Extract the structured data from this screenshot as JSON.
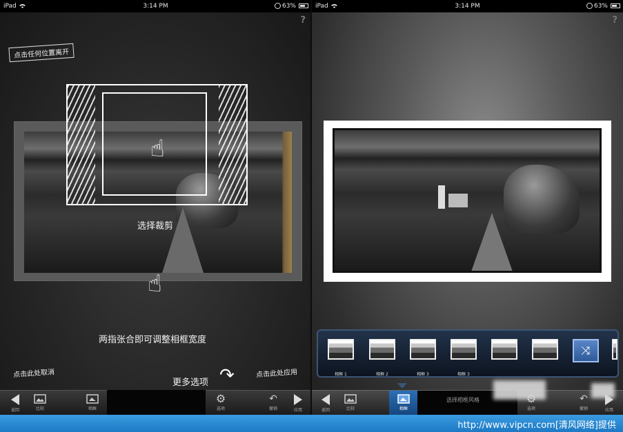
{
  "status_bar": {
    "device": "iPad",
    "time": "3:14 PM",
    "battery": "63%"
  },
  "help_glyph": "?",
  "left": {
    "exit_hint": "点击任何位置离开",
    "crop_caption": "选择裁剪",
    "pinch_caption": "两指张合即可调整相框宽度",
    "cancel_hint": "点击此处取消",
    "more_options": "更多选项",
    "apply_hint": "点击此处应用",
    "toolbar": {
      "back_label": "返回",
      "compare_label": "比较",
      "frame_label": "相框",
      "options_label": "选项",
      "undo_label": "撤销",
      "apply_label": "应用"
    }
  },
  "right": {
    "frames": [
      {
        "label": "相框 1"
      },
      {
        "label": "相框 2"
      },
      {
        "label": "相框 3"
      },
      {
        "label": "相框 3"
      },
      {
        "label": ""
      },
      {
        "label": ""
      }
    ],
    "toolbar": {
      "back_label": "返回",
      "compare_label": "比较",
      "frame_label": "相框",
      "center_text": "选择相框风格",
      "options_label": "选项",
      "undo_label": "撤销",
      "apply_label": "应用"
    }
  },
  "footer": {
    "credit": "http://www.vipcn.com[清风网络]提供"
  },
  "colors": {
    "accent": "#2b6fb6",
    "footer": "#1d79c4",
    "chalk": "#ffffff"
  },
  "icons": [
    "wifi-icon",
    "lock-icon",
    "battery-icon",
    "hand-icon",
    "shuffle-icon",
    "image-icon",
    "gear-icon",
    "undo-icon"
  ]
}
